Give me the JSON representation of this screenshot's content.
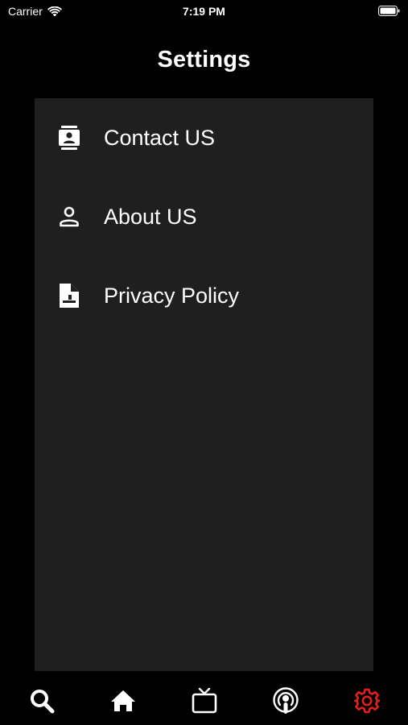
{
  "status_bar": {
    "carrier": "Carrier",
    "time": "7:19 PM"
  },
  "header": {
    "title": "Settings"
  },
  "menu": {
    "items": [
      {
        "label": "Contact US",
        "icon": "contact-card-icon"
      },
      {
        "label": "About US",
        "icon": "person-icon"
      },
      {
        "label": "Privacy Policy",
        "icon": "document-icon"
      }
    ]
  },
  "tab_bar": {
    "tabs": [
      {
        "name": "search",
        "icon": "search-icon",
        "active": false
      },
      {
        "name": "home",
        "icon": "home-icon",
        "active": false
      },
      {
        "name": "tv",
        "icon": "tv-icon",
        "active": false
      },
      {
        "name": "podcast",
        "icon": "podcast-icon",
        "active": false
      },
      {
        "name": "settings",
        "icon": "gear-icon",
        "active": true
      }
    ]
  },
  "colors": {
    "background": "#000000",
    "panel": "#1f1f1f",
    "text": "#ffffff",
    "active_tab": "#e0201b"
  }
}
